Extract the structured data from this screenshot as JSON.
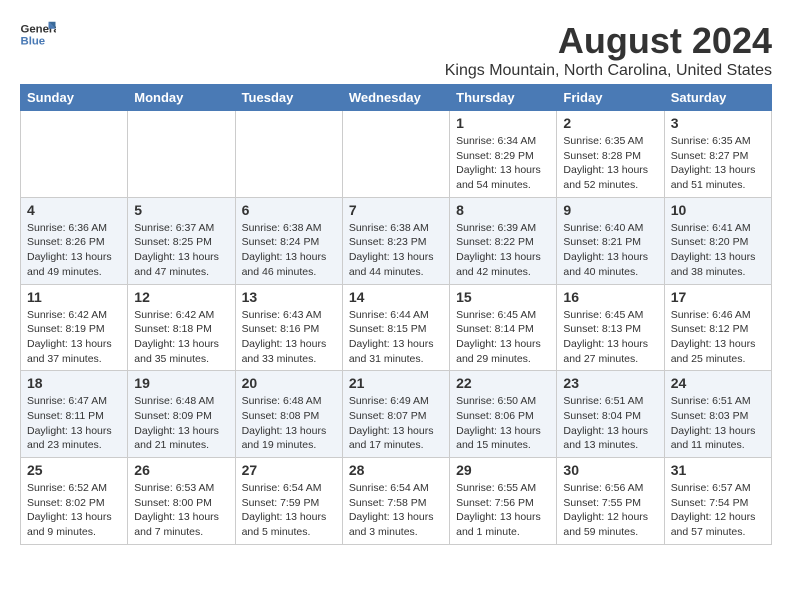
{
  "logo": {
    "line1": "General",
    "line2": "Blue"
  },
  "title": "August 2024",
  "subtitle": "Kings Mountain, North Carolina, United States",
  "weekdays": [
    "Sunday",
    "Monday",
    "Tuesday",
    "Wednesday",
    "Thursday",
    "Friday",
    "Saturday"
  ],
  "weeks": [
    [
      {
        "day": "",
        "info": ""
      },
      {
        "day": "",
        "info": ""
      },
      {
        "day": "",
        "info": ""
      },
      {
        "day": "",
        "info": ""
      },
      {
        "day": "1",
        "info": "Sunrise: 6:34 AM\nSunset: 8:29 PM\nDaylight: 13 hours\nand 54 minutes."
      },
      {
        "day": "2",
        "info": "Sunrise: 6:35 AM\nSunset: 8:28 PM\nDaylight: 13 hours\nand 52 minutes."
      },
      {
        "day": "3",
        "info": "Sunrise: 6:35 AM\nSunset: 8:27 PM\nDaylight: 13 hours\nand 51 minutes."
      }
    ],
    [
      {
        "day": "4",
        "info": "Sunrise: 6:36 AM\nSunset: 8:26 PM\nDaylight: 13 hours\nand 49 minutes."
      },
      {
        "day": "5",
        "info": "Sunrise: 6:37 AM\nSunset: 8:25 PM\nDaylight: 13 hours\nand 47 minutes."
      },
      {
        "day": "6",
        "info": "Sunrise: 6:38 AM\nSunset: 8:24 PM\nDaylight: 13 hours\nand 46 minutes."
      },
      {
        "day": "7",
        "info": "Sunrise: 6:38 AM\nSunset: 8:23 PM\nDaylight: 13 hours\nand 44 minutes."
      },
      {
        "day": "8",
        "info": "Sunrise: 6:39 AM\nSunset: 8:22 PM\nDaylight: 13 hours\nand 42 minutes."
      },
      {
        "day": "9",
        "info": "Sunrise: 6:40 AM\nSunset: 8:21 PM\nDaylight: 13 hours\nand 40 minutes."
      },
      {
        "day": "10",
        "info": "Sunrise: 6:41 AM\nSunset: 8:20 PM\nDaylight: 13 hours\nand 38 minutes."
      }
    ],
    [
      {
        "day": "11",
        "info": "Sunrise: 6:42 AM\nSunset: 8:19 PM\nDaylight: 13 hours\nand 37 minutes."
      },
      {
        "day": "12",
        "info": "Sunrise: 6:42 AM\nSunset: 8:18 PM\nDaylight: 13 hours\nand 35 minutes."
      },
      {
        "day": "13",
        "info": "Sunrise: 6:43 AM\nSunset: 8:16 PM\nDaylight: 13 hours\nand 33 minutes."
      },
      {
        "day": "14",
        "info": "Sunrise: 6:44 AM\nSunset: 8:15 PM\nDaylight: 13 hours\nand 31 minutes."
      },
      {
        "day": "15",
        "info": "Sunrise: 6:45 AM\nSunset: 8:14 PM\nDaylight: 13 hours\nand 29 minutes."
      },
      {
        "day": "16",
        "info": "Sunrise: 6:45 AM\nSunset: 8:13 PM\nDaylight: 13 hours\nand 27 minutes."
      },
      {
        "day": "17",
        "info": "Sunrise: 6:46 AM\nSunset: 8:12 PM\nDaylight: 13 hours\nand 25 minutes."
      }
    ],
    [
      {
        "day": "18",
        "info": "Sunrise: 6:47 AM\nSunset: 8:11 PM\nDaylight: 13 hours\nand 23 minutes."
      },
      {
        "day": "19",
        "info": "Sunrise: 6:48 AM\nSunset: 8:09 PM\nDaylight: 13 hours\nand 21 minutes."
      },
      {
        "day": "20",
        "info": "Sunrise: 6:48 AM\nSunset: 8:08 PM\nDaylight: 13 hours\nand 19 minutes."
      },
      {
        "day": "21",
        "info": "Sunrise: 6:49 AM\nSunset: 8:07 PM\nDaylight: 13 hours\nand 17 minutes."
      },
      {
        "day": "22",
        "info": "Sunrise: 6:50 AM\nSunset: 8:06 PM\nDaylight: 13 hours\nand 15 minutes."
      },
      {
        "day": "23",
        "info": "Sunrise: 6:51 AM\nSunset: 8:04 PM\nDaylight: 13 hours\nand 13 minutes."
      },
      {
        "day": "24",
        "info": "Sunrise: 6:51 AM\nSunset: 8:03 PM\nDaylight: 13 hours\nand 11 minutes."
      }
    ],
    [
      {
        "day": "25",
        "info": "Sunrise: 6:52 AM\nSunset: 8:02 PM\nDaylight: 13 hours\nand 9 minutes."
      },
      {
        "day": "26",
        "info": "Sunrise: 6:53 AM\nSunset: 8:00 PM\nDaylight: 13 hours\nand 7 minutes."
      },
      {
        "day": "27",
        "info": "Sunrise: 6:54 AM\nSunset: 7:59 PM\nDaylight: 13 hours\nand 5 minutes."
      },
      {
        "day": "28",
        "info": "Sunrise: 6:54 AM\nSunset: 7:58 PM\nDaylight: 13 hours\nand 3 minutes."
      },
      {
        "day": "29",
        "info": "Sunrise: 6:55 AM\nSunset: 7:56 PM\nDaylight: 13 hours\nand 1 minute."
      },
      {
        "day": "30",
        "info": "Sunrise: 6:56 AM\nSunset: 7:55 PM\nDaylight: 12 hours\nand 59 minutes."
      },
      {
        "day": "31",
        "info": "Sunrise: 6:57 AM\nSunset: 7:54 PM\nDaylight: 12 hours\nand 57 minutes."
      }
    ]
  ]
}
